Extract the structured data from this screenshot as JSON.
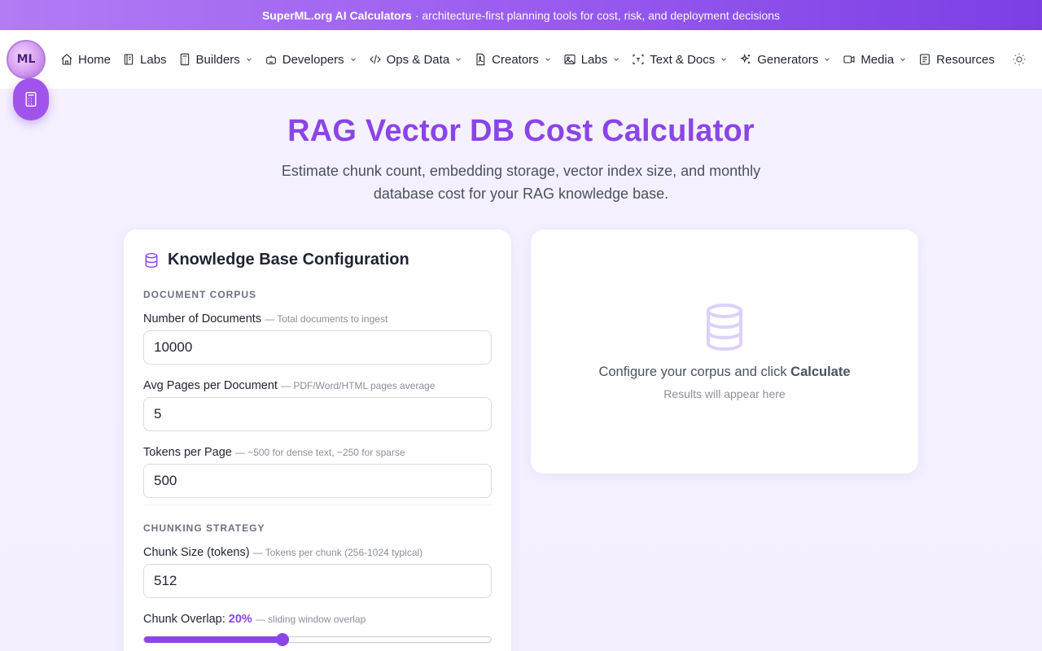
{
  "banner": {
    "brand": "SuperML.org AI Calculators",
    "tagline": "· architecture-first planning tools for cost, risk, and deployment decisions"
  },
  "logo": {
    "text": "ML"
  },
  "nav": {
    "items": [
      {
        "label": "Home",
        "icon": "home-icon",
        "dropdown": false
      },
      {
        "label": "Labs",
        "icon": "notebook-icon",
        "dropdown": false
      },
      {
        "label": "Builders",
        "icon": "calculator-icon",
        "dropdown": true
      },
      {
        "label": "Developers",
        "icon": "robot-icon",
        "dropdown": true
      },
      {
        "label": "Ops & Data",
        "icon": "code-icon",
        "dropdown": true
      },
      {
        "label": "Creators",
        "icon": "document-icon",
        "dropdown": true
      },
      {
        "label": "Labs",
        "icon": "image-icon",
        "dropdown": true
      },
      {
        "label": "Text & Docs",
        "icon": "scan-text-icon",
        "dropdown": true
      },
      {
        "label": "Generators",
        "icon": "sparkles-icon",
        "dropdown": true
      },
      {
        "label": "Media",
        "icon": "video-icon",
        "dropdown": true
      },
      {
        "label": "Resources",
        "icon": "list-icon",
        "dropdown": false
      }
    ],
    "theme_toggle_icon": "sun-icon"
  },
  "hero": {
    "title": "RAG Vector DB Cost Calculator",
    "subtitle": "Estimate chunk count, embedding storage, vector index size, and monthly database cost for your RAG knowledge base."
  },
  "config": {
    "title": "Knowledge Base Configuration",
    "sections": {
      "corpus": "DOCUMENT CORPUS",
      "chunking": "CHUNKING STRATEGY"
    },
    "fields": {
      "num_docs": {
        "label": "Number of Documents",
        "hint": "— Total documents to ingest",
        "value": "10000"
      },
      "avg_pages": {
        "label": "Avg Pages per Document",
        "hint": "— PDF/Word/HTML pages average",
        "value": "5"
      },
      "tokens_per_page": {
        "label": "Tokens per Page",
        "hint": "— ~500 for dense text, ~250 for sparse",
        "value": "500"
      },
      "chunk_size": {
        "label": "Chunk Size (tokens)",
        "hint": "— Tokens per chunk (256-1024 typical)",
        "value": "512"
      },
      "overlap": {
        "label": "Chunk Overlap: ",
        "value_text": "20%",
        "hint": "— sliding window overlap",
        "fraction": 0.4
      }
    }
  },
  "results": {
    "empty_main_prefix": "Configure your corpus and click ",
    "empty_main_strong": "Calculate",
    "empty_sub": "Results will appear here"
  }
}
